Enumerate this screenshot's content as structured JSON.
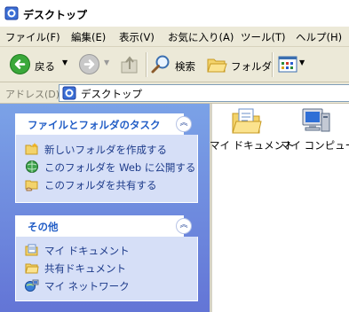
{
  "window": {
    "title": "デスクトップ"
  },
  "menu": {
    "items": [
      "ファイル(F)",
      "編集(E)",
      "表示(V)",
      "お気に入り(A)",
      "ツール(T)",
      "ヘルプ(H)"
    ]
  },
  "toolbar": {
    "back_label": "戻る",
    "search_label": "検索",
    "folders_label": "フォルダ"
  },
  "address": {
    "label": "アドレス(D)",
    "value": "デスクトップ"
  },
  "tasks_panel": {
    "title": "ファイルとフォルダのタスク",
    "items": [
      {
        "label": "新しいフォルダを作成する",
        "icon": "new-folder-icon"
      },
      {
        "label": "このフォルダを Web に公開する",
        "icon": "web-publish-icon"
      },
      {
        "label": "このフォルダを共有する",
        "icon": "share-folder-icon"
      }
    ]
  },
  "other_panel": {
    "title": "その他",
    "items": [
      {
        "label": "マイ ドキュメント",
        "icon": "my-documents-icon"
      },
      {
        "label": "共有ドキュメント",
        "icon": "shared-documents-icon"
      },
      {
        "label": "マイ ネットワーク",
        "icon": "my-network-icon"
      }
    ]
  },
  "desktop_items": [
    {
      "label": "マイ ドキュメント",
      "icon": "my-documents-folder-icon"
    },
    {
      "label": "マイ コンピュータ",
      "icon": "my-computer-icon"
    }
  ],
  "colors": {
    "pane_gradient_top": "#7ba2e7",
    "pane_gradient_bottom": "#6375d6",
    "panel_title": "#215dc6",
    "panel_body": "#d6dff7"
  }
}
